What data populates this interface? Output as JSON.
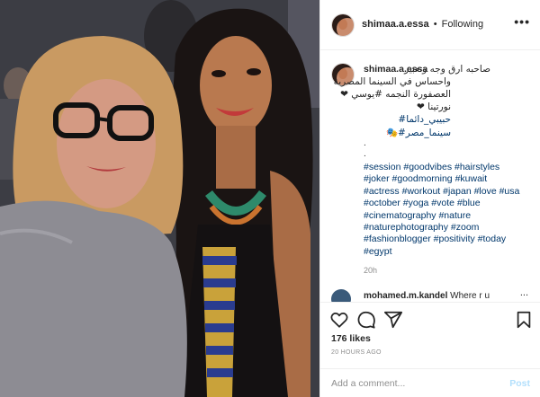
{
  "header": {
    "username": "shimaa.a.essa",
    "separator": "•",
    "follow_status": "Following",
    "more": "•••"
  },
  "caption": {
    "username": "shimaa.a.essa",
    "arabic_lines": [
      "صاحبه ارق وجه وتعبير",
      "واحساس في السينما المصرية",
      "العصفورة النجمه #يوسي ❤",
      "نورتينا ❤"
    ],
    "arabic_tags": [
      "حبيبي_دائما#",
      "سينما_مصر#🎭"
    ],
    "dots": [
      ".",
      "."
    ],
    "hashtag_lines": [
      "#session #goodvibes #hairstyles",
      "#joker #goodmorning #kuwait",
      "#actress #workout #japan #love #usa",
      "#october #yoga #vote #blue",
      "#cinematography #nature",
      "#naturephotography #zoom",
      "#fashionblogger #positivity #today",
      "#egypt"
    ],
    "time": "20h"
  },
  "next_comment": {
    "username": "mohamed.m.kandel",
    "text": "Where r u",
    "more": "..."
  },
  "actions": {
    "like_icon": "heart-outline-icon",
    "comment_icon": "speech-bubble-icon",
    "share_icon": "paper-plane-icon",
    "save_icon": "bookmark-icon",
    "likes": "176 likes",
    "posted": "20 HOURS AGO"
  },
  "comment_box": {
    "placeholder": "Add a comment...",
    "post_label": "Post"
  },
  "colors": {
    "link_blue": "#00376b",
    "muted_gray": "#8e8e8e",
    "post_disabled": "#b2dffc",
    "border": "#efefef"
  }
}
